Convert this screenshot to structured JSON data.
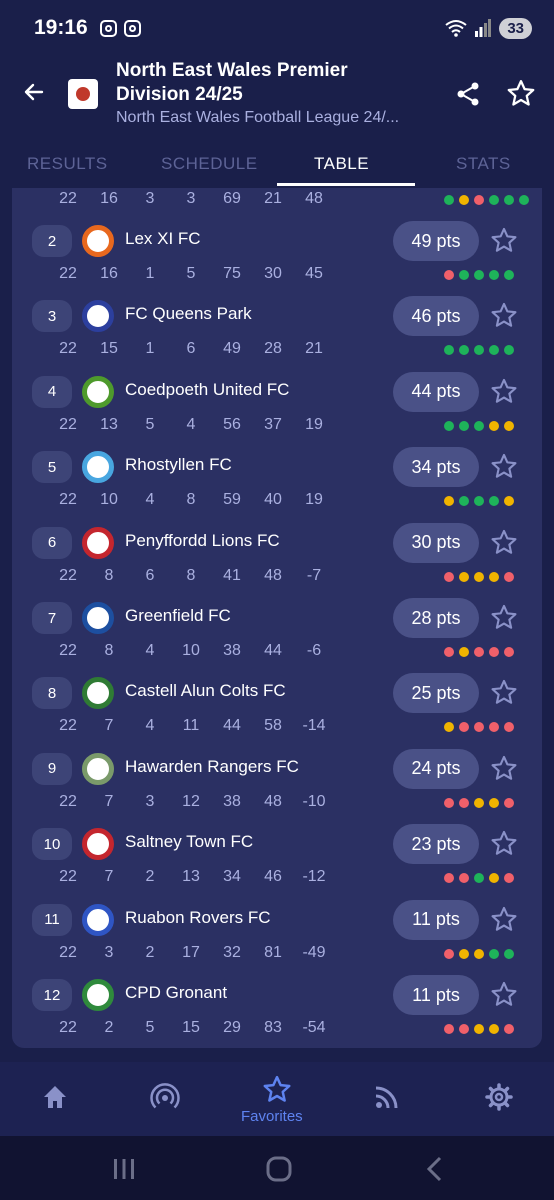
{
  "status": {
    "time": "19:16",
    "battery": "33"
  },
  "header": {
    "title": "North East Wales Premier Division 24/25",
    "subtitle": "North East Wales Football League 24/..."
  },
  "tabs": [
    {
      "label": "RESULTS"
    },
    {
      "label": "SCHEDULE"
    },
    {
      "label": "TABLE"
    },
    {
      "label": "STATS"
    }
  ],
  "colors": {
    "win": "#1eb35a",
    "draw": "#f0b400",
    "loss": "#f0606a",
    "accent": "#5e83f0"
  },
  "top_partial_row": {
    "played": "22",
    "won": "16",
    "drawn": "3",
    "lost": "3",
    "gf": "69",
    "ga": "21",
    "gd": "48",
    "form": [
      "W",
      "D",
      "L",
      "W",
      "W",
      "W"
    ]
  },
  "rows": [
    {
      "pos": "2",
      "team": "Lex XI FC",
      "pts": "49 pts",
      "played": "22",
      "won": "16",
      "drawn": "1",
      "lost": "5",
      "gf": "75",
      "ga": "30",
      "gd": "45",
      "form": [
        "L",
        "W",
        "W",
        "W",
        "W"
      ],
      "logo_color": "#e8681e"
    },
    {
      "pos": "3",
      "team": "FC Queens Park",
      "pts": "46 pts",
      "played": "22",
      "won": "15",
      "drawn": "1",
      "lost": "6",
      "gf": "49",
      "ga": "28",
      "gd": "21",
      "form": [
        "W",
        "W",
        "W",
        "W",
        "W"
      ],
      "logo_color": "#2c3f9e"
    },
    {
      "pos": "4",
      "team": "Coedpoeth United FC",
      "pts": "44 pts",
      "played": "22",
      "won": "13",
      "drawn": "5",
      "lost": "4",
      "gf": "56",
      "ga": "37",
      "gd": "19",
      "form": [
        "W",
        "W",
        "W",
        "D",
        "D"
      ],
      "logo_color": "#4e9a2c"
    },
    {
      "pos": "5",
      "team": "Rhostyllen FC",
      "pts": "34 pts",
      "played": "22",
      "won": "10",
      "drawn": "4",
      "lost": "8",
      "gf": "59",
      "ga": "40",
      "gd": "19",
      "form": [
        "D",
        "W",
        "W",
        "W",
        "D"
      ],
      "logo_color": "#48a6e0"
    },
    {
      "pos": "6",
      "team": "Penyffordd Lions FC",
      "pts": "30 pts",
      "played": "22",
      "won": "8",
      "drawn": "6",
      "lost": "8",
      "gf": "41",
      "ga": "48",
      "gd": "-7",
      "form": [
        "L",
        "D",
        "D",
        "D",
        "L"
      ],
      "logo_color": "#c4262e"
    },
    {
      "pos": "7",
      "team": "Greenfield FC",
      "pts": "28 pts",
      "played": "22",
      "won": "8",
      "drawn": "4",
      "lost": "10",
      "gf": "38",
      "ga": "44",
      "gd": "-6",
      "form": [
        "L",
        "D",
        "L",
        "L",
        "L"
      ],
      "logo_color": "#1d4fa0"
    },
    {
      "pos": "8",
      "team": "Castell Alun Colts FC",
      "pts": "25 pts",
      "played": "22",
      "won": "7",
      "drawn": "4",
      "lost": "11",
      "gf": "44",
      "ga": "58",
      "gd": "-14",
      "form": [
        "D",
        "L",
        "L",
        "L",
        "L"
      ],
      "logo_color": "#2f7b34"
    },
    {
      "pos": "9",
      "team": "Hawarden Rangers FC",
      "pts": "24 pts",
      "played": "22",
      "won": "7",
      "drawn": "3",
      "lost": "12",
      "gf": "38",
      "ga": "48",
      "gd": "-10",
      "form": [
        "L",
        "L",
        "D",
        "D",
        "L"
      ],
      "logo_color": "#7a9a6a"
    },
    {
      "pos": "10",
      "team": "Saltney Town FC",
      "pts": "23 pts",
      "played": "22",
      "won": "7",
      "drawn": "2",
      "lost": "13",
      "gf": "34",
      "ga": "46",
      "gd": "-12",
      "form": [
        "L",
        "L",
        "W",
        "D",
        "L"
      ],
      "logo_color": "#c4262e"
    },
    {
      "pos": "11",
      "team": "Ruabon Rovers FC",
      "pts": "11 pts",
      "played": "22",
      "won": "3",
      "drawn": "2",
      "lost": "17",
      "gf": "32",
      "ga": "81",
      "gd": "-49",
      "form": [
        "L",
        "D",
        "D",
        "W",
        "W"
      ],
      "logo_color": "#2f55c4"
    },
    {
      "pos": "12",
      "team": "CPD Gronant",
      "pts": "11 pts",
      "played": "22",
      "won": "2",
      "drawn": "5",
      "lost": "15",
      "gf": "29",
      "ga": "83",
      "gd": "-54",
      "form": [
        "L",
        "L",
        "D",
        "D",
        "L"
      ],
      "logo_color": "#2f8a3c"
    }
  ],
  "bottom_nav": {
    "items": [
      {
        "icon": "home-icon"
      },
      {
        "icon": "broadcast-icon"
      },
      {
        "icon": "star-icon",
        "label": "Favorites"
      },
      {
        "icon": "feed-icon"
      },
      {
        "icon": "gear-icon"
      }
    ]
  }
}
